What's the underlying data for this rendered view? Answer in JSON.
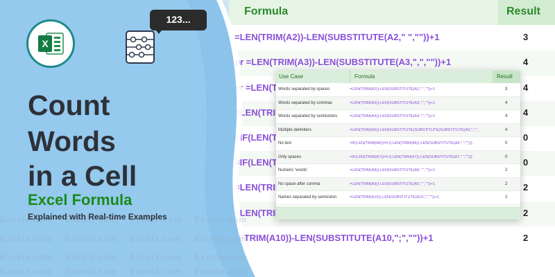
{
  "background_sheet": {
    "header_formula": "Formula",
    "header_result": "Result",
    "rows": [
      {
        "formula": "=LEN(TRIM(A2))-LEN(SUBSTITUTE(A2,\" \",\"\"))+1",
        "result": "3"
      },
      {
        "formula": "pr =LEN(TRIM(A3))-LEN(SUBSTITUTE(A3,\",\",\"\"))+1",
        "result": "4"
      },
      {
        "formula": "er =LEN(TRIM",
        "result": "4"
      },
      {
        "formula": "=LEN(TRIM",
        "result": "4"
      },
      {
        "formula": "=IF(LEN(T",
        "result": "0"
      },
      {
        "formula": "=IF(LEN(T",
        "result": "0"
      },
      {
        "formula": "=LEN(TRIM",
        "result": "2"
      },
      {
        "formula": "=LEN(TRIM",
        "result": "2"
      },
      {
        "formula": "N(TRIM(A10))-LEN(SUBSTITUTE(A10,\";\",\"\"))+1",
        "result": "2"
      }
    ],
    "watermark": "Excelx.com"
  },
  "logo": {
    "icon": "excel-icon",
    "bubble_text": "123..."
  },
  "title": {
    "line1": "Count",
    "line2": "Words",
    "line3": "in a Cell",
    "subtitle": "Excel Formula",
    "tagline": "Explained with Real-time Examples"
  },
  "table": {
    "headers": {
      "use_case": "Use Case",
      "formula": "Formula",
      "result": "Result"
    },
    "rows": [
      {
        "use_case": "Words separated by spaces",
        "formula": "=LEN(TRIM(A2))-LEN(SUBSTITUTE(A2,\" \",\"\"))+1",
        "result": "3"
      },
      {
        "use_case": "Words separated by commas",
        "formula": "=LEN(TRIM(A3))-LEN(SUBSTITUTE(A3,\",\",\"\"))+1",
        "result": "4"
      },
      {
        "use_case": "Words separated by semicolons",
        "formula": "=LEN(TRIM(A4))-LEN(SUBSTITUTE(A4,\";\",\"\"))+1",
        "result": "4"
      },
      {
        "use_case": "Multiple delimiters",
        "formula": "=LEN(TRIM(A5))-LEN(SUBSTITUTE(SUBSTITUTE(SUBSTITUTE(A5,\",\",\",",
        "result": "4"
      },
      {
        "use_case": "No text",
        "formula": "=IF(LEN(TRIM(A6))=0,0,LEN(TRIM(A6))-LEN(SUBSTITUTE(A6,\" \",\"\")))",
        "result": "0"
      },
      {
        "use_case": "Only spaces",
        "formula": "=IF(LEN(TRIM(A7))=0,0,LEN(TRIM(A7))-LEN(SUBSTITUTE(A7,\" \",\"\")))",
        "result": "0"
      },
      {
        "use_case": "Numeric 'words'",
        "formula": "=LEN(TRIM(A8))-LEN(SUBSTITUTE(A8,\" \",\"\"))+1",
        "result": "2"
      },
      {
        "use_case": "No space after comma",
        "formula": "=LEN(TRIM(A9))-LEN(SUBSTITUTE(A9,\" \",\"\"))+1",
        "result": "2"
      },
      {
        "use_case": "Names separated by semicolon",
        "formula": "=LEN(TRIM(A10))-LEN(SUBSTITUTE(A10,\";\",\"\"))+1",
        "result": "2"
      }
    ]
  },
  "colors": {
    "panel_blue": "#8cc3ea",
    "formula_purple": "#8b4fd8",
    "excel_green": "#1a8a1a",
    "header_green": "#dbeedb"
  }
}
